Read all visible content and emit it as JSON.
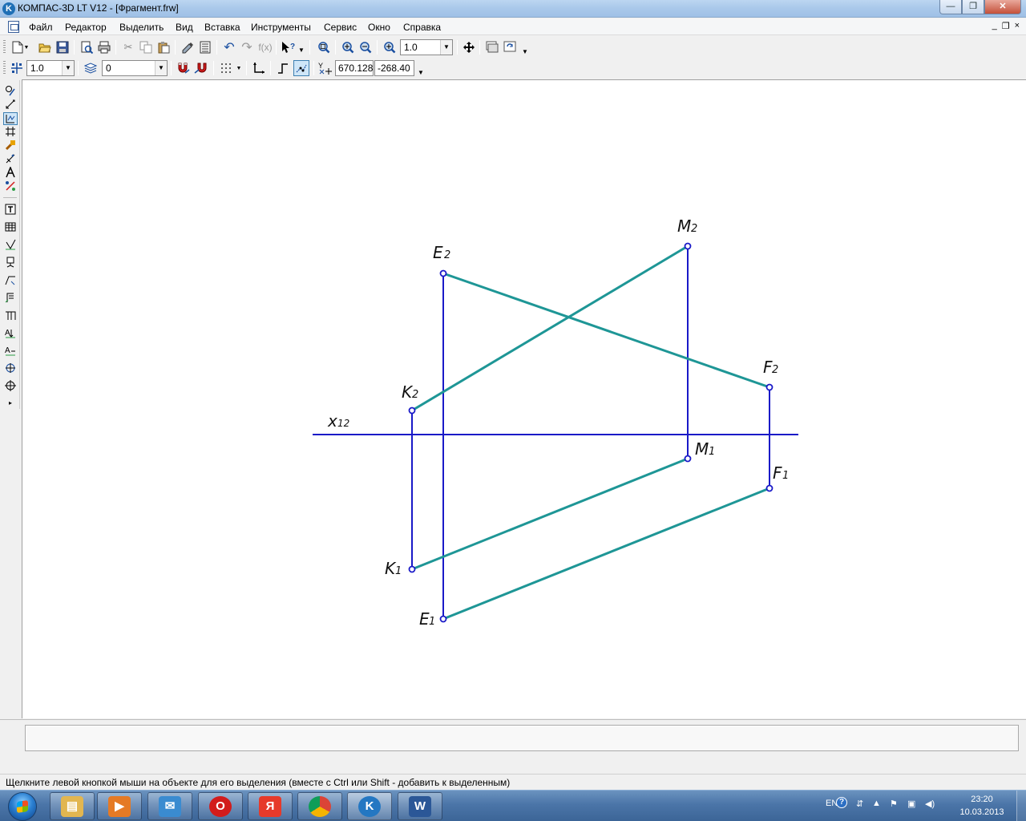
{
  "window": {
    "title": "КОМПАС-3D LT V12 - [Фрагмент.frw]",
    "app_icon": "K",
    "controls": {
      "minimize": "—",
      "maximize": "❐",
      "close": "✕"
    }
  },
  "menubar": {
    "items": [
      {
        "label": "Файл"
      },
      {
        "label": "Редактор"
      },
      {
        "label": "Выделить"
      },
      {
        "label": "Вид"
      },
      {
        "label": "Вставка"
      },
      {
        "label": "Инструменты"
      },
      {
        "label": "Сервис"
      },
      {
        "label": "Окно"
      },
      {
        "label": "Справка"
      }
    ],
    "mdi_controls": {
      "minimize": "_",
      "restore": "❐",
      "close": "×"
    }
  },
  "toolbar_standard": {
    "zoom_value": "1.0",
    "icons": [
      "new-document-icon",
      "open-folder-icon",
      "save-icon",
      "print-preview-icon",
      "print-icon",
      "cut-icon",
      "copy-icon",
      "paste-icon",
      "format-painter-icon",
      "properties-icon",
      "undo-icon",
      "redo-icon",
      "function-icon",
      "help-pointer-icon",
      "zoom-window-icon",
      "zoom-in-icon",
      "zoom-out-icon",
      "zoom-scale-icon",
      "pan-icon",
      "layer-manager-icon",
      "refresh-icon"
    ],
    "function_label": "f(x)"
  },
  "toolbar_current_state": {
    "step_value": "1.0",
    "layer_value": "0",
    "x_coordinate": "670.128",
    "y_coordinate": "-268.40",
    "coord_label": "Y"
  },
  "left_panel": {
    "icons": [
      "geometry-icon",
      "dimensions-icon",
      "designations-icon",
      "editing-icon",
      "parametrization-icon",
      "measurements-icon",
      "selection-icon",
      "library-icon",
      "variables-icon",
      "text-icon",
      "table-icon",
      "roughness-icon",
      "base-icon",
      "leader-icon",
      "tolerance-icon",
      "view-arrow-icon",
      "cut-line-icon",
      "section-icon",
      "center-mark-icon",
      "axis-icon"
    ]
  },
  "drawing": {
    "axis_label": "x",
    "axis_subscript": "12",
    "colors": {
      "projection_line": "#1a1ac8",
      "segment": "#1e9696"
    },
    "points": [
      {
        "letter": "E",
        "sub": "2"
      },
      {
        "letter": "M",
        "sub": "2"
      },
      {
        "letter": "K",
        "sub": "2"
      },
      {
        "letter": "F",
        "sub": "2"
      },
      {
        "letter": "M",
        "sub": "1"
      },
      {
        "letter": "F",
        "sub": "1"
      },
      {
        "letter": "K",
        "sub": "1"
      },
      {
        "letter": "E",
        "sub": "1"
      }
    ]
  },
  "status": {
    "message": "Щелкните левой кнопкой мыши на объекте для его выделения (вместе с Ctrl или Shift - добавить к выделенным)"
  },
  "taskbar": {
    "apps": [
      {
        "name": "explorer",
        "color": "#e2b650",
        "glyph": "▤"
      },
      {
        "name": "media-player",
        "color": "#e57a25",
        "glyph": "▶"
      },
      {
        "name": "mail",
        "color": "#3a8bd0",
        "glyph": "✉"
      },
      {
        "name": "opera",
        "color": "#d21c1c",
        "glyph": "O"
      },
      {
        "name": "yandex",
        "color": "#e63a2a",
        "glyph": "Я"
      },
      {
        "name": "chrome",
        "color": "#3a9c43",
        "glyph": "◉"
      },
      {
        "name": "kompas",
        "color": "#2477c2",
        "glyph": "K"
      },
      {
        "name": "word",
        "color": "#2b5797",
        "glyph": "W"
      }
    ],
    "language": "EN",
    "time": "23:20",
    "date": "10.03.2013"
  }
}
